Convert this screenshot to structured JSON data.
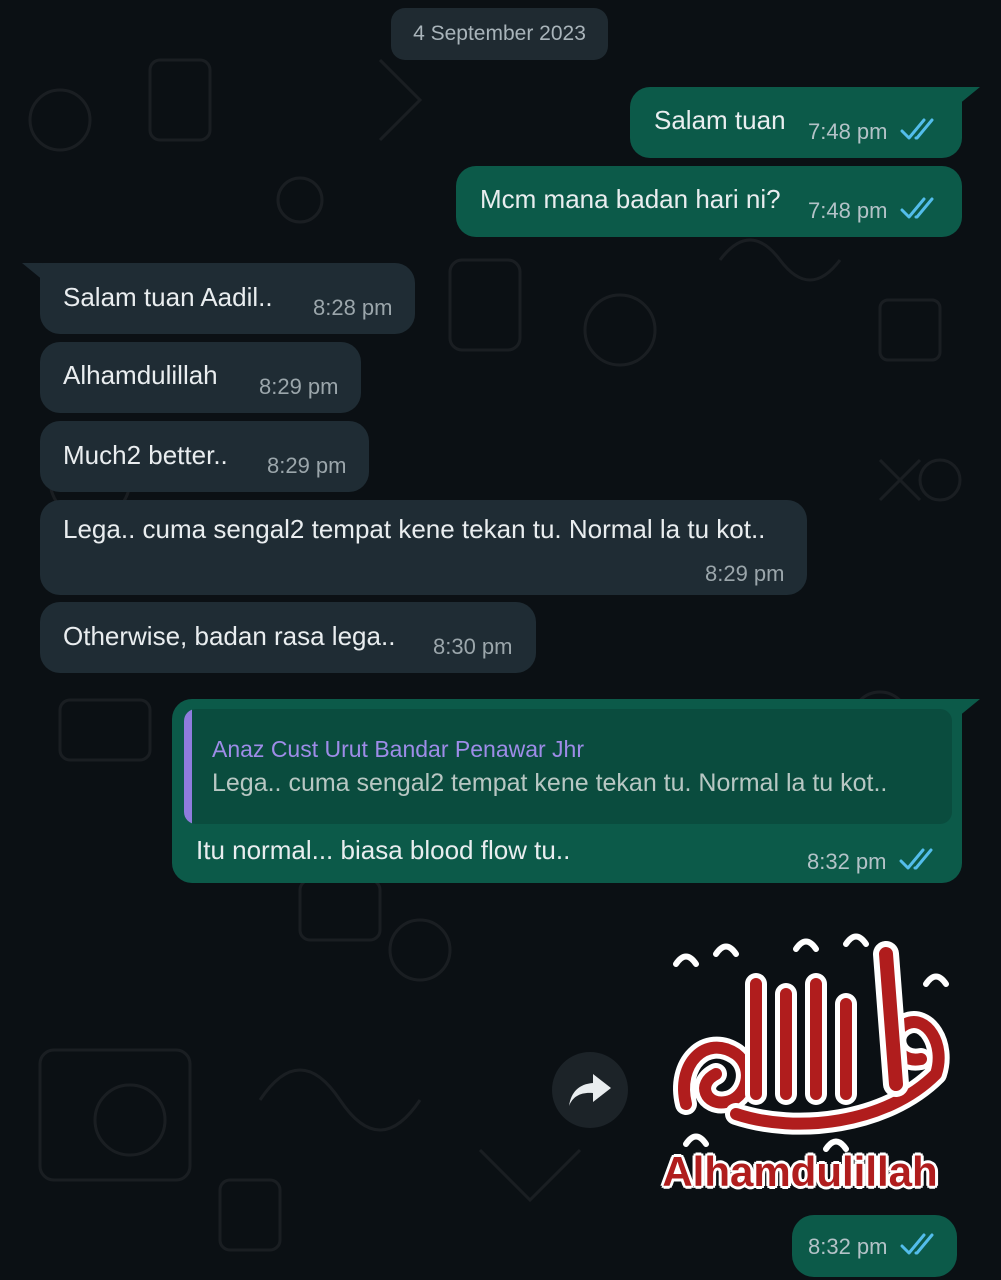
{
  "date_chip": "4 September 2023",
  "messages": [
    {
      "text": "Salam tuan",
      "time": "7:48 pm"
    },
    {
      "text": "Mcm mana badan hari ni?",
      "time": "7:48 pm"
    },
    {
      "text": "Salam tuan Aadil..",
      "time": "8:28 pm"
    },
    {
      "text": "Alhamdulillah",
      "time": "8:29 pm"
    },
    {
      "text": "Much2 better..",
      "time": "8:29 pm"
    },
    {
      "text": "Lega.. cuma sengal2 tempat kene tekan tu. Normal la tu kot..",
      "time": "8:29 pm"
    },
    {
      "text": "Otherwise, badan rasa lega..",
      "time": "8:30 pm"
    },
    {
      "text": "Itu normal... biasa blood flow tu..",
      "time": "8:32 pm"
    },
    {
      "text": "",
      "time": "8:32 pm"
    }
  ],
  "reply_quote": {
    "author": "Anaz Cust Urut Bandar Penawar Jhr",
    "text": "Lega.. cuma sengal2 tempat kene tekan tu. Normal la tu kot.."
  },
  "sticker": {
    "caption": "Alhamdulillah"
  },
  "colors": {
    "outgoing_bubble": "#0c5a49",
    "incoming_bubble": "#1f2c34",
    "read_ticks": "#53bdeb",
    "quote_author": "#9e8ce8"
  }
}
